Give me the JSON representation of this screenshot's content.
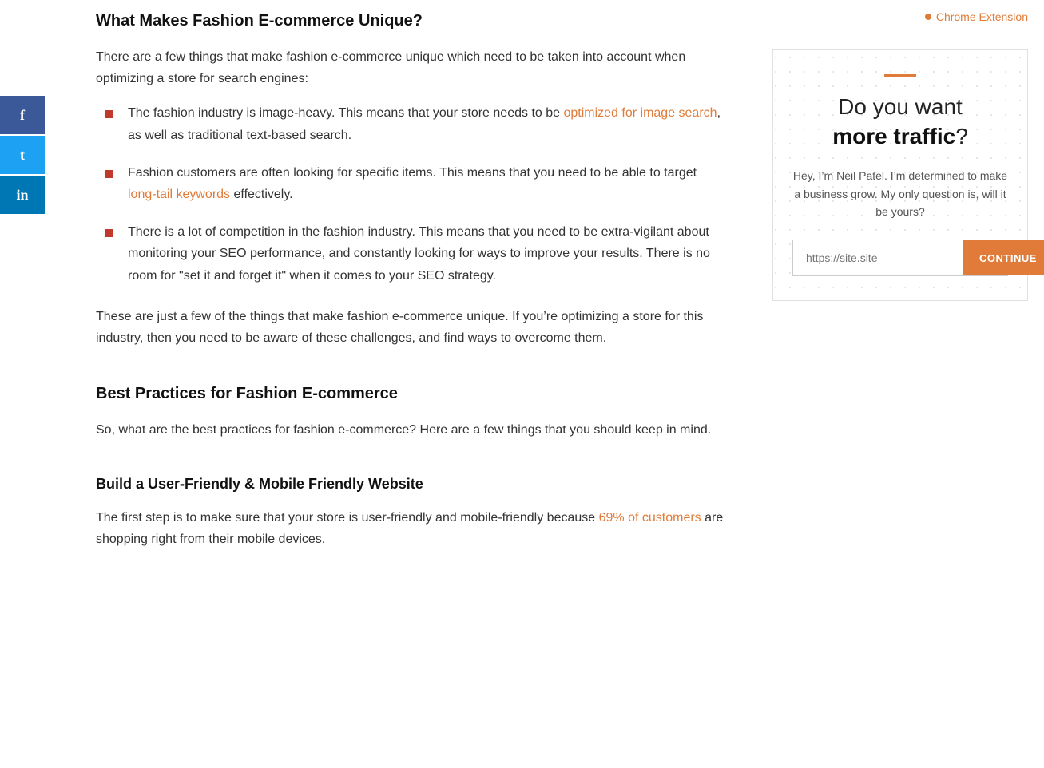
{
  "social": {
    "facebook_label": "f",
    "twitter_label": "t",
    "linkedin_label": "in"
  },
  "header": {
    "chrome_extension_label": "Chrome Extension"
  },
  "article": {
    "section1": {
      "heading": "What Makes Fashion E-commerce Unique?",
      "intro": "There are a few things that make fashion e-commerce unique which need to be taken into account when optimizing a store for search engines:",
      "bullets": [
        {
          "text_before": "The fashion industry is image-heavy. This means that your store needs to be ",
          "link_text": "optimized for image search",
          "text_after": ", as well as traditional text-based search."
        },
        {
          "text_before": "Fashion customers are often looking for specific items. This means that you need to be able to target ",
          "link_text": "long-tail keywords",
          "text_after": " effectively."
        },
        {
          "text_before": "There is a lot of competition in the fashion industry. This means that you need to be extra-vigilant about monitoring your SEO performance, and constantly looking for ways to improve your results. There is no room for “set it and forget it” when it comes to your SEO strategy.",
          "link_text": "",
          "text_after": ""
        }
      ],
      "outro": "These are just a few of the things that make fashion e-commerce unique. If you’re optimizing a store for this industry, then you need to be aware of these challenges, and find ways to overcome them."
    },
    "section2": {
      "heading": "Best Practices for Fashion E-commerce",
      "intro": "So, what are the best practices for fashion e-commerce? Here are a few things that you should keep in mind."
    },
    "section3": {
      "heading": "Build a User-Friendly & Mobile Friendly Website",
      "intro_before": "The first step is to make sure that your store is user-friendly and mobile-friendly because ",
      "link_text": "69% of customers",
      "intro_after": " are shopping right from their mobile devices."
    }
  },
  "widget": {
    "accent": true,
    "title_line1": "Do you want",
    "title_bold": "more traffic",
    "title_punctuation": "?",
    "description": "Hey, I’m Neil Patel. I’m determined to make a business grow. My only question is, will it be yours?",
    "input_placeholder": "https://site.site",
    "button_label": "CONTINUE"
  }
}
